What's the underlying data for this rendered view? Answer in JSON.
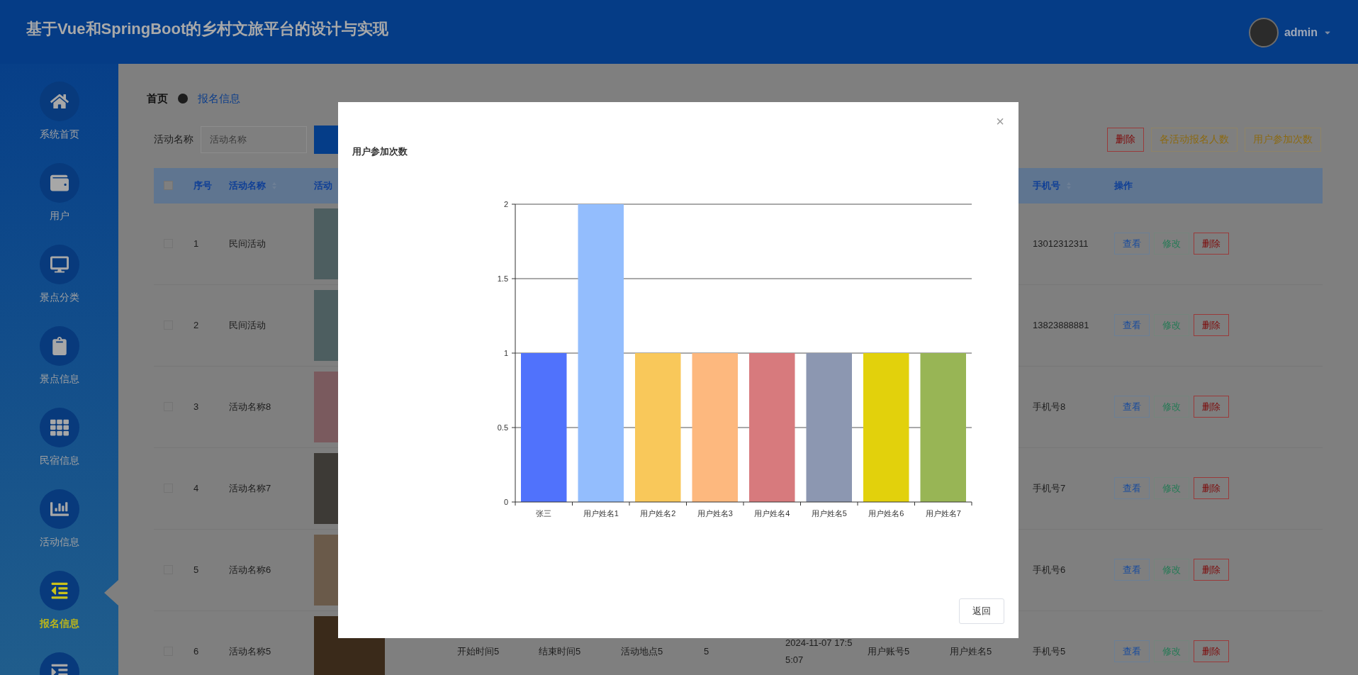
{
  "header": {
    "title": "基于Vue和SpringBoot的乡村文旅平台的设计与实现",
    "user": "admin"
  },
  "sidebar": {
    "items": [
      {
        "label": "系统首页",
        "selected": false
      },
      {
        "label": "用户",
        "selected": false
      },
      {
        "label": "景点分类",
        "selected": false
      },
      {
        "label": "景点信息",
        "selected": false
      },
      {
        "label": "民宿信息",
        "selected": false
      },
      {
        "label": "活动信息",
        "selected": false
      },
      {
        "label": "报名信息",
        "selected": true
      },
      {
        "selected": false
      }
    ]
  },
  "breadcrumb": [
    "首页",
    "报名信息"
  ],
  "search": {
    "label": "活动名称",
    "placeholder": "活动名称"
  },
  "toolbar": [
    {
      "label": "删除",
      "kind": "danger"
    },
    {
      "label": "各活动报名人数",
      "kind": "warning"
    },
    {
      "label": "用户参加次数",
      "kind": "warning"
    }
  ],
  "table": {
    "header": {
      "checked": false,
      "index": "序号",
      "name": "活动名称",
      "image": "活动",
      "phone": "手机号",
      "actions": "操作"
    },
    "rows": [
      {
        "checked": false,
        "index": "1",
        "name": "民间活动",
        "phone": "13012312311",
        "actions": [
          {
            "label": "查看",
            "kind": "view"
          },
          {
            "label": "修改",
            "kind": "edit"
          },
          {
            "label": "删除",
            "kind": "delete"
          }
        ]
      },
      {
        "checked": false,
        "index": "2",
        "name": "民间活动",
        "phone": "13823888881",
        "actions": [
          {
            "label": "查看",
            "kind": "view"
          },
          {
            "label": "修改",
            "kind": "edit"
          },
          {
            "label": "删除",
            "kind": "delete"
          }
        ]
      },
      {
        "checked": false,
        "index": "3",
        "name": "活动名称8",
        "phone": "手机号8",
        "actions": [
          {
            "label": "查看",
            "kind": "view"
          },
          {
            "label": "修改",
            "kind": "edit"
          },
          {
            "label": "删除",
            "kind": "delete"
          }
        ]
      },
      {
        "checked": false,
        "index": "4",
        "name": "活动名称7",
        "phone": "手机号7",
        "actions": [
          {
            "label": "查看",
            "kind": "view"
          },
          {
            "label": "修改",
            "kind": "edit"
          },
          {
            "label": "删除",
            "kind": "delete"
          }
        ]
      },
      {
        "checked": false,
        "index": "5",
        "name": "活动名称6",
        "phone": "手机号6",
        "actions": [
          {
            "label": "查看",
            "kind": "view"
          },
          {
            "label": "修改",
            "kind": "edit"
          },
          {
            "label": "删除",
            "kind": "delete"
          }
        ]
      },
      {
        "checked": false,
        "index": "6",
        "name": "活动名称5",
        "start": "开始时间5",
        "end": "结束时间5",
        "place": "活动地点5",
        "count": "5",
        "time": "2024-11-07 17:55:07",
        "account": "用户账号5",
        "user": "用户姓名5",
        "phone": "手机号5",
        "actions": [
          {
            "label": "查看",
            "kind": "view"
          },
          {
            "label": "修改",
            "kind": "edit"
          },
          {
            "label": "删除",
            "kind": "delete"
          }
        ]
      }
    ]
  },
  "modal": {
    "close": "×",
    "button": "返回",
    "chart_data": {
      "type": "bar",
      "title": "用户参加次数",
      "categories": [
        "张三",
        "用户姓名1",
        "用户姓名2",
        "用户姓名3",
        "用户姓名4",
        "用户姓名5",
        "用户姓名6",
        "用户姓名7"
      ],
      "series": [
        {
          "color": "#5072fc",
          "values": [
            1,
            null,
            null,
            null,
            null,
            null,
            null,
            null
          ]
        },
        {
          "color": "#93bdfd",
          "values": [
            null,
            2,
            null,
            null,
            null,
            null,
            null,
            null
          ]
        },
        {
          "color": "#f9c85a",
          "values": [
            null,
            null,
            1,
            null,
            null,
            null,
            null,
            null
          ]
        },
        {
          "color": "#fdb87e",
          "values": [
            null,
            null,
            null,
            1,
            null,
            null,
            null,
            null
          ]
        },
        {
          "color": "#d77a7d",
          "values": [
            null,
            null,
            null,
            null,
            1,
            null,
            null,
            null
          ]
        },
        {
          "color": "#8c97b1",
          "values": [
            null,
            null,
            null,
            null,
            null,
            1,
            null,
            null
          ]
        },
        {
          "color": "#e2d10c",
          "values": [
            null,
            null,
            null,
            null,
            null,
            null,
            1,
            null
          ]
        },
        {
          "color": "#98b555",
          "values": [
            null,
            null,
            null,
            null,
            null,
            null,
            null,
            1
          ]
        }
      ],
      "stacked": true,
      "grid": true,
      "ylim": [
        0,
        2
      ],
      "yticks": [
        0,
        0.5,
        1,
        1.5,
        2
      ]
    }
  }
}
